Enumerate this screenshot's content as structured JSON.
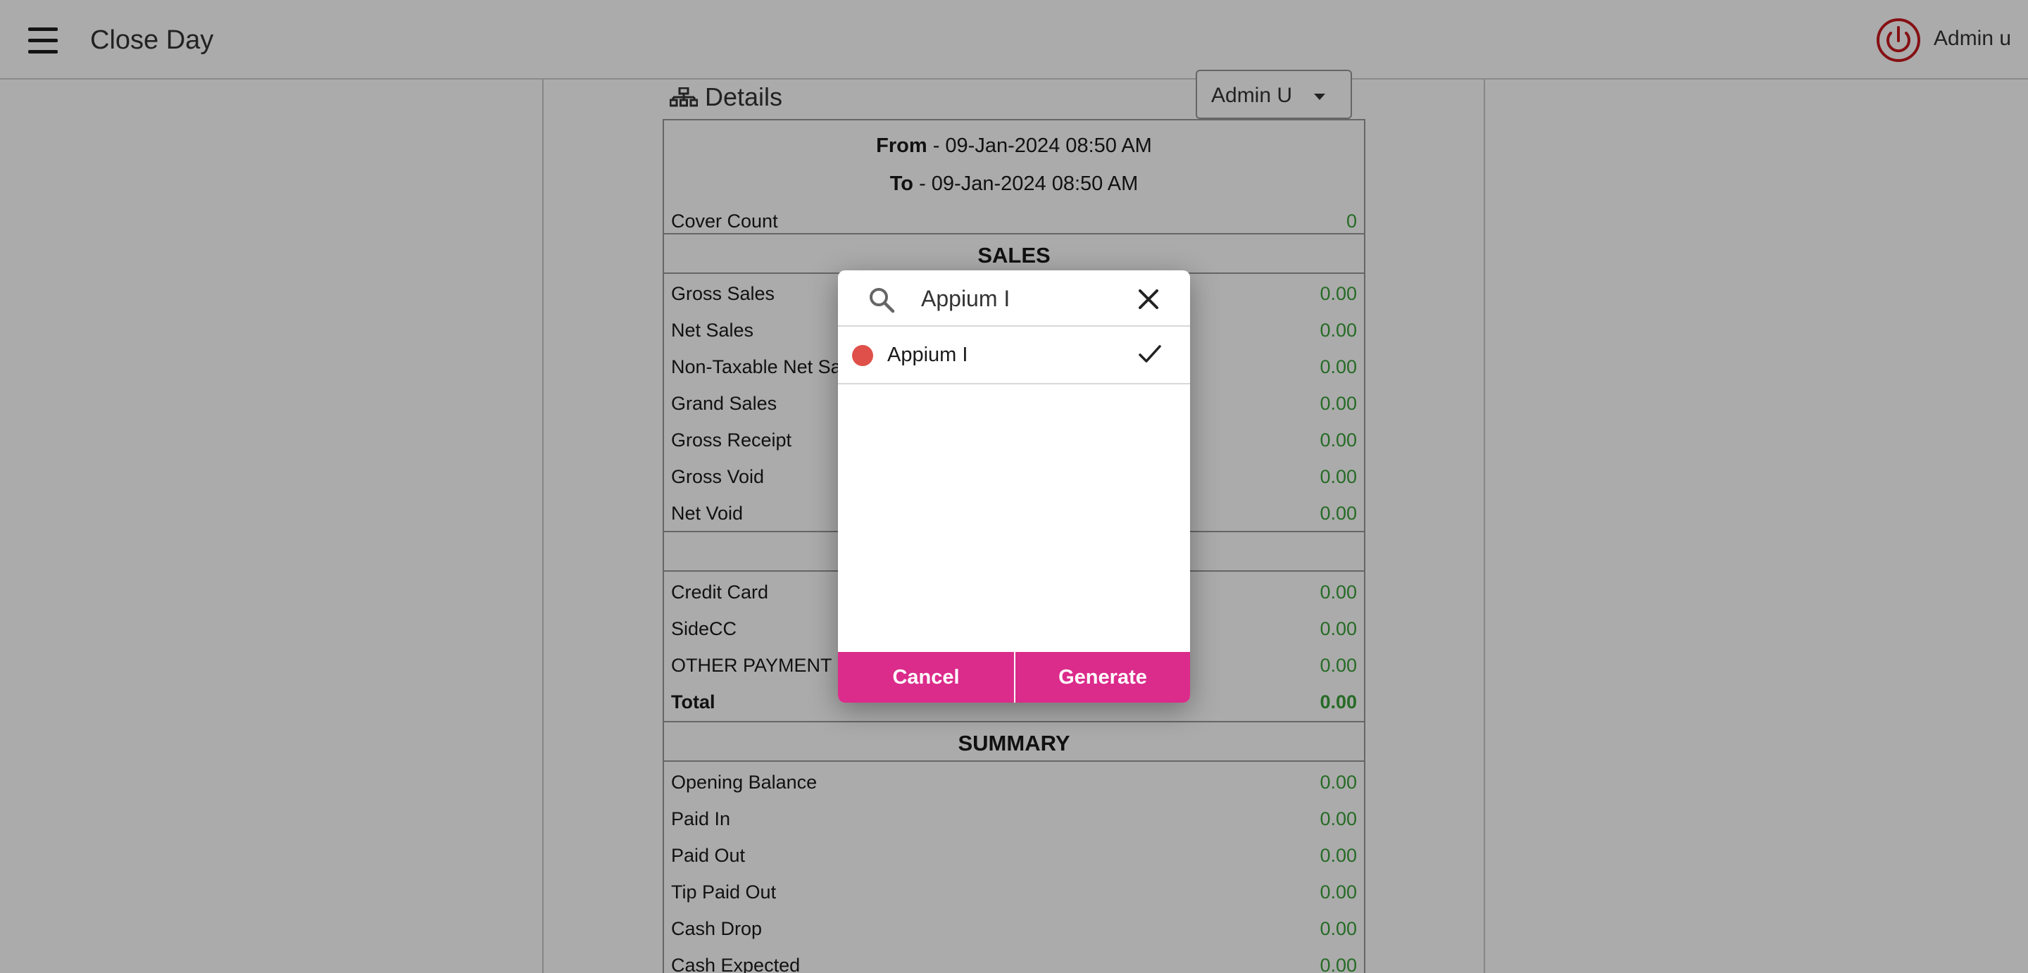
{
  "header": {
    "title": "Close Day",
    "user": "Admin u"
  },
  "details": {
    "title": "Details",
    "user_select_value": "Admin U",
    "from_label": "From",
    "from_value": " - 09-Jan-2024 08:50 AM",
    "to_label": "To",
    "to_value": " - 09-Jan-2024 08:50 AM",
    "cover_count_label": "Cover Count",
    "cover_count_value": "0"
  },
  "sales": {
    "heading": "SALES",
    "rows": [
      {
        "label": "Gross Sales",
        "value": "0.00"
      },
      {
        "label": "Net Sales",
        "value": "0.00"
      },
      {
        "label": "Non-Taxable Net Sal",
        "value": "0.00"
      },
      {
        "label": "Grand Sales",
        "value": "0.00"
      },
      {
        "label": "Gross Receipt",
        "value": "0.00"
      },
      {
        "label": "Gross Void",
        "value": "0.00"
      },
      {
        "label": "Net Void",
        "value": "0.00"
      }
    ]
  },
  "payments": {
    "heading": "",
    "rows": [
      {
        "label": "Credit Card",
        "value": "0.00"
      },
      {
        "label": "SideCC",
        "value": "0.00"
      },
      {
        "label": "OTHER PAYMENT",
        "value": "0.00"
      },
      {
        "label": "Total",
        "value": "0.00"
      }
    ]
  },
  "summary": {
    "heading": "SUMMARY",
    "rows": [
      {
        "label": "Opening Balance",
        "value": "0.00"
      },
      {
        "label": "Paid In",
        "value": "0.00"
      },
      {
        "label": "Paid Out",
        "value": "0.00"
      },
      {
        "label": "Tip Paid Out",
        "value": "0.00"
      },
      {
        "label": "Cash Drop",
        "value": "0.00"
      },
      {
        "label": "Cash Expected",
        "value": "0.00"
      }
    ]
  },
  "modal": {
    "search_value": "Appium I",
    "options": [
      {
        "label": "Appium I",
        "selected": true
      }
    ],
    "cancel_label": "Cancel",
    "generate_label": "Generate"
  },
  "colors": {
    "accent": "#db2b8b",
    "value_green": "#3aa03a",
    "option_dot": "#e0504a",
    "power_red": "#c8191e"
  },
  "icons": {
    "menu": "hamburger-menu-icon",
    "power": "power-icon",
    "details": "sitemap-icon",
    "search": "search-icon",
    "close": "close-icon",
    "check": "checkmark-icon",
    "dropdown": "caret-down-icon"
  }
}
